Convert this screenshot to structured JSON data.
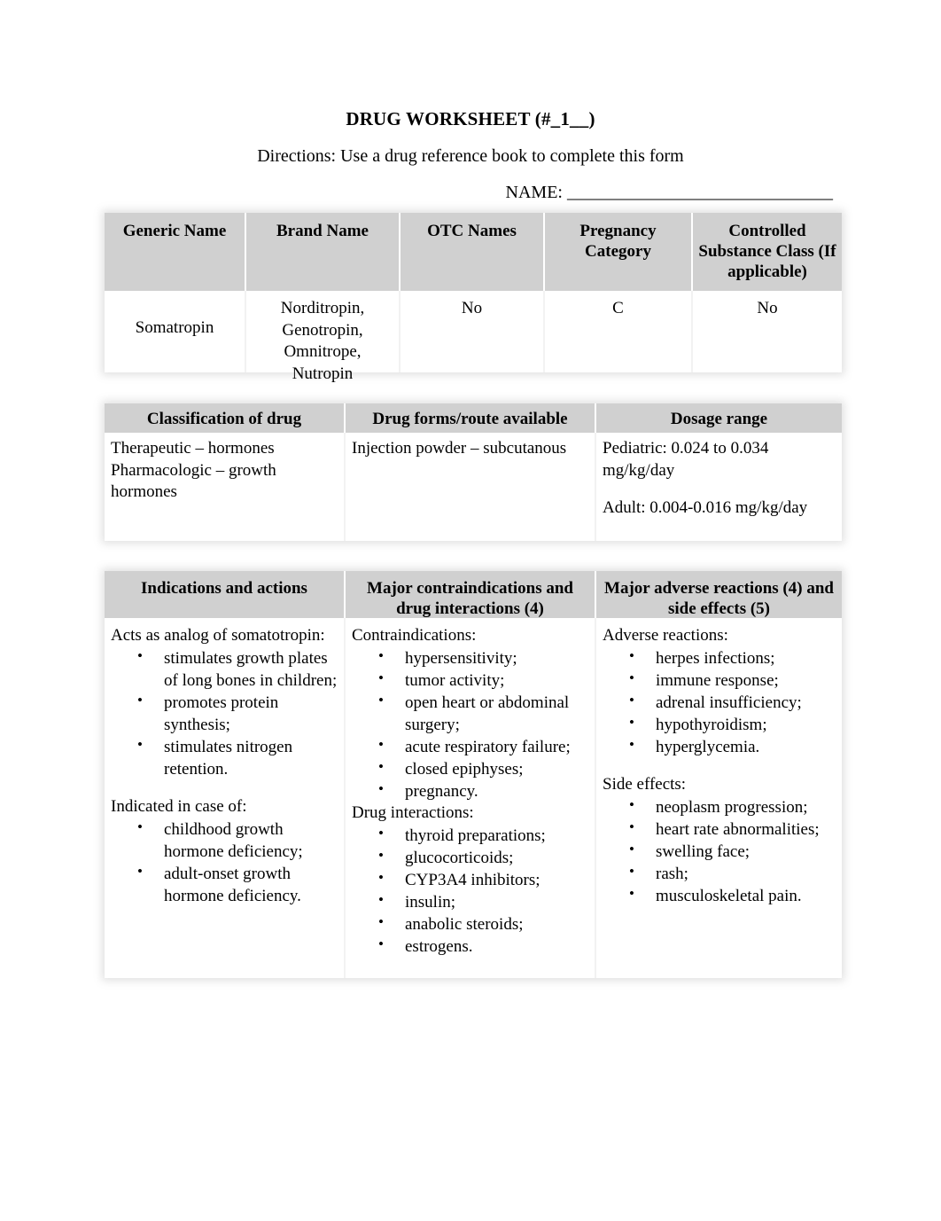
{
  "document": {
    "title": "DRUG WORKSHEET (#_1__)",
    "directions": "Directions: Use a drug reference book to complete this form",
    "name_label": "NAME: ______________________________"
  },
  "table_basic": {
    "headers": [
      "Generic Name",
      "Brand Name",
      "OTC Names",
      "Pregnancy Category",
      "Controlled Substance Class (If applicable)"
    ],
    "row": {
      "generic_name": "Somatropin",
      "brand_name": "Norditropin, Genotropin, Omnitrope, Nutropin",
      "otc_names": "No",
      "pregnancy_category": "C",
      "controlled_substance_class": "No"
    }
  },
  "table_classification": {
    "headers": [
      "Classification of drug",
      "Drug forms/route available",
      "Dosage range"
    ],
    "classification": "Therapeutic – hormones Pharmacologic – growth hormones",
    "drug_forms": "Injection powder – subcutanous",
    "dosage_pediatric": "Pediatric: 0.024 to 0.034 mg/kg/day",
    "dosage_adult": "Adult: 0.004-0.016 mg/kg/day"
  },
  "table_effects": {
    "headers": [
      "Indications and actions",
      "Major contraindications and drug interactions (4)",
      "Major adverse reactions (4) and side effects (5)"
    ],
    "indications": {
      "lead_1": "Acts as analog of somatotropin:",
      "actions": [
        "stimulates growth plates of long bones in children;",
        "promotes protein synthesis;",
        "stimulates nitrogen retention."
      ],
      "lead_2": "Indicated in case of:",
      "indicated": [
        "childhood growth hormone deficiency;",
        "adult-onset growth hormone deficiency."
      ]
    },
    "contraindications": {
      "lead_1": "Contraindications:",
      "items": [
        "hypersensitivity;",
        "tumor activity;",
        "open heart or abdominal surgery;",
        "acute respiratory failure;",
        "closed epiphyses;",
        "pregnancy."
      ],
      "lead_2": "Drug interactions:",
      "interactions": [
        "thyroid preparations;",
        "glucocorticoids;",
        "CYP3A4 inhibitors;",
        "insulin;",
        "anabolic steroids;",
        "estrogens."
      ]
    },
    "adverse": {
      "lead_1": "Adverse reactions:",
      "reactions": [
        "herpes infections;",
        "immune response;",
        "adrenal insufficiency;",
        "hypothyroidism;",
        "hyperglycemia."
      ],
      "lead_2": "Side effects:",
      "side_effects": [
        "neoplasm progression;",
        "heart rate abnormalities;",
        "swelling face;",
        "rash;",
        "musculoskeletal pain."
      ]
    }
  },
  "colors": {
    "header_gray": "#d0d0d0",
    "page_background": "#ffffff",
    "text": "#000000"
  }
}
